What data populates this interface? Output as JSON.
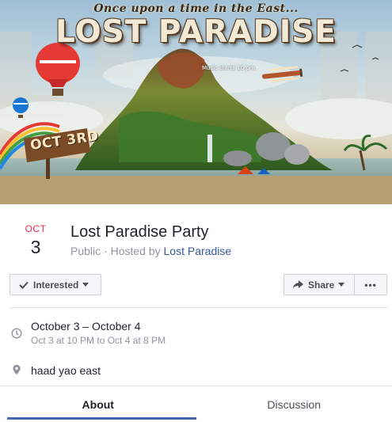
{
  "cover": {
    "tagline": "Once upon a time in the East...",
    "title": "LOST PARADISE",
    "music_note": "Music starts 10 pm.",
    "sign_text": "OCT 3RD"
  },
  "event": {
    "date_month": "OCT",
    "date_day": "3",
    "title": "Lost Paradise Party",
    "privacy": "Public",
    "hosted_prefix": " · Hosted by ",
    "host": "Lost Paradise"
  },
  "actions": {
    "interested_label": "Interested",
    "share_label": "Share",
    "more_label": "•••"
  },
  "details": {
    "when_main": "October 3 – October 4",
    "when_sub": "Oct 3 at 10 PM to Oct 4 at 8 PM",
    "where_main": "haad yao east"
  },
  "tabs": [
    {
      "label": "About",
      "active": true
    },
    {
      "label": "Discussion",
      "active": false
    }
  ],
  "colors": {
    "accent_blue": "#4267b2",
    "link_blue": "#365899",
    "date_red": "#f02849"
  },
  "icons": {
    "interested": "checkmark-icon",
    "share": "share-arrow-icon",
    "when": "clock-icon",
    "where": "location-pin-icon"
  }
}
